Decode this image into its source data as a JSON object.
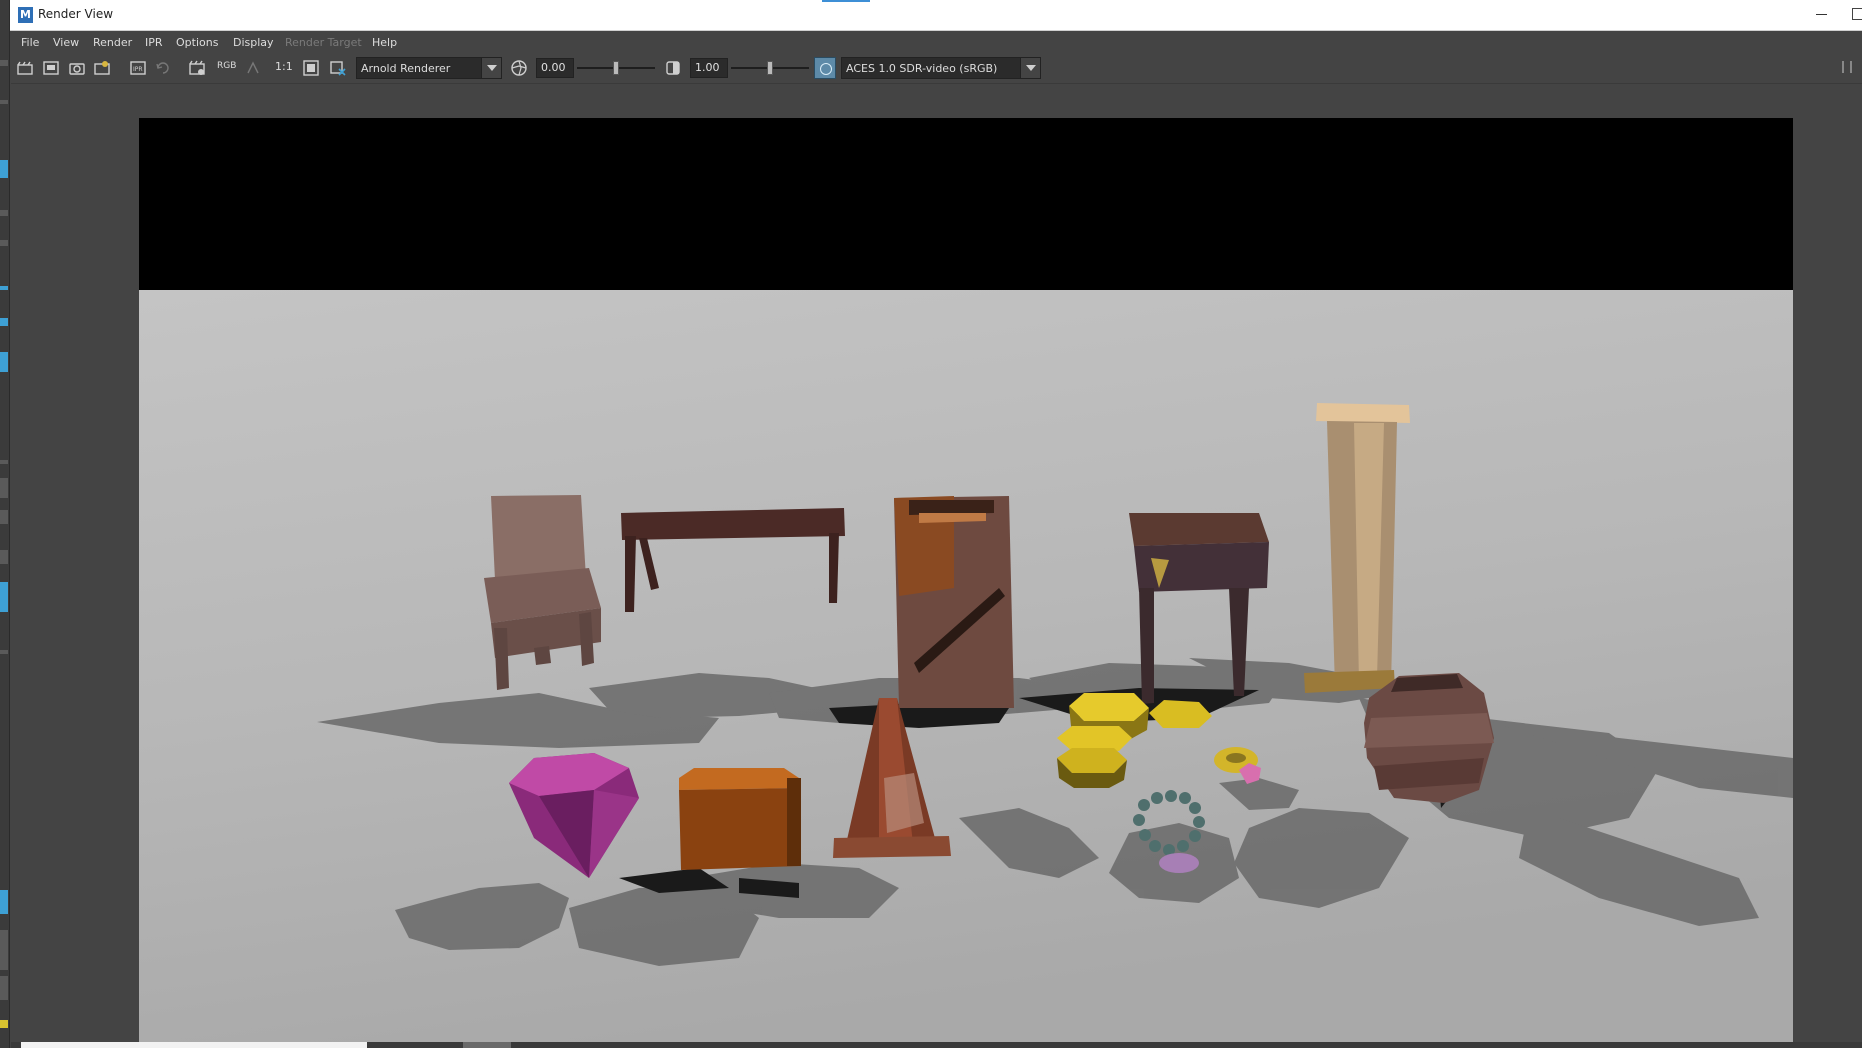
{
  "window": {
    "title": "Render View",
    "app_icon_letter": "M",
    "icon_names": [
      "maya-app-icon",
      "minimize-icon",
      "maximize-icon"
    ]
  },
  "menu": {
    "items": [
      {
        "label": "File",
        "enabled": true
      },
      {
        "label": "View",
        "enabled": true
      },
      {
        "label": "Render",
        "enabled": true
      },
      {
        "label": "IPR",
        "enabled": true
      },
      {
        "label": "Options",
        "enabled": true
      },
      {
        "label": "Display",
        "enabled": true
      },
      {
        "label": "Render Target",
        "enabled": false
      },
      {
        "label": "Help",
        "enabled": true
      }
    ]
  },
  "toolbar": {
    "rgb_label": "RGB",
    "one_to_one_label": "1:1",
    "renderer": "Arnold Renderer",
    "exposure_value": "0.00",
    "gamma_value": "1.00",
    "exposure_level": 0.5,
    "gamma_level": 0.5,
    "view_transform": "ACES 1.0 SDR-video (sRGB)",
    "icons": [
      "render-frame-icon",
      "snapshot-icon",
      "camera-icon",
      "render-region-icon",
      "ipr-icon",
      "refresh-icon",
      "keep-image-icon",
      "rgb-channel-icon",
      "real-size-icon",
      "frame-image-icon",
      "clear-image-icon",
      "exposure-icon",
      "gamma-icon",
      "color-management-icon"
    ]
  },
  "render": {
    "letterbox_color": "#000000",
    "floor_color": "#b9b9b9",
    "objects": [
      "chair",
      "bench",
      "crate",
      "stool",
      "pillar",
      "gem",
      "chest",
      "cone",
      "coins",
      "ring",
      "necklace",
      "barrel"
    ]
  },
  "colors": {
    "panel": "#444444",
    "field": "#2b2b2b",
    "accent": "#3ea0d4"
  }
}
